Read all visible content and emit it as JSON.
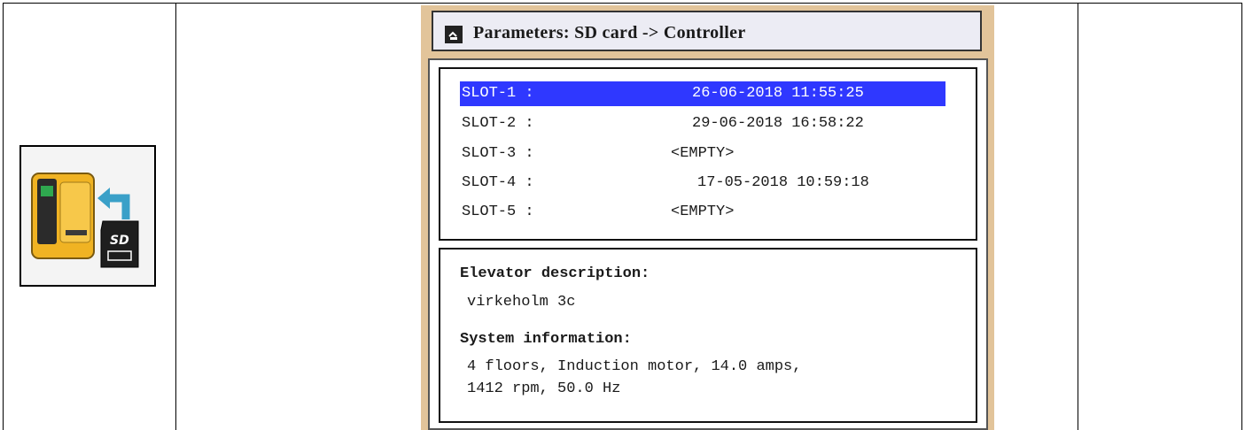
{
  "title": "Parameters: SD card -> Controller",
  "title_icon": "sd-to-controller-icon",
  "slots": [
    {
      "label": "SLOT-1 :",
      "value": "26-06-2018 11:55:25",
      "selected": true
    },
    {
      "label": "SLOT-2 :",
      "value": "29-06-2018 16:58:22",
      "selected": false
    },
    {
      "label": "SLOT-3 :",
      "value": "<EMPTY>",
      "selected": false
    },
    {
      "label": "SLOT-4 :",
      "value": "17-05-2018 10:59:18",
      "selected": false
    },
    {
      "label": "SLOT-5 :",
      "value": "<EMPTY>",
      "selected": false
    }
  ],
  "elevator": {
    "heading": "Elevator description:",
    "text": "virkeholm 3c"
  },
  "system": {
    "heading": "System information:",
    "line1": "4 floors, Induction motor, 14.0 amps,",
    "line2": "1412 rpm, 50.0 Hz"
  },
  "colors": {
    "selection": "#2f38ff",
    "screen_border": "#e2c49a",
    "controller": "#f0b323",
    "arrow": "#3aa0c8"
  }
}
